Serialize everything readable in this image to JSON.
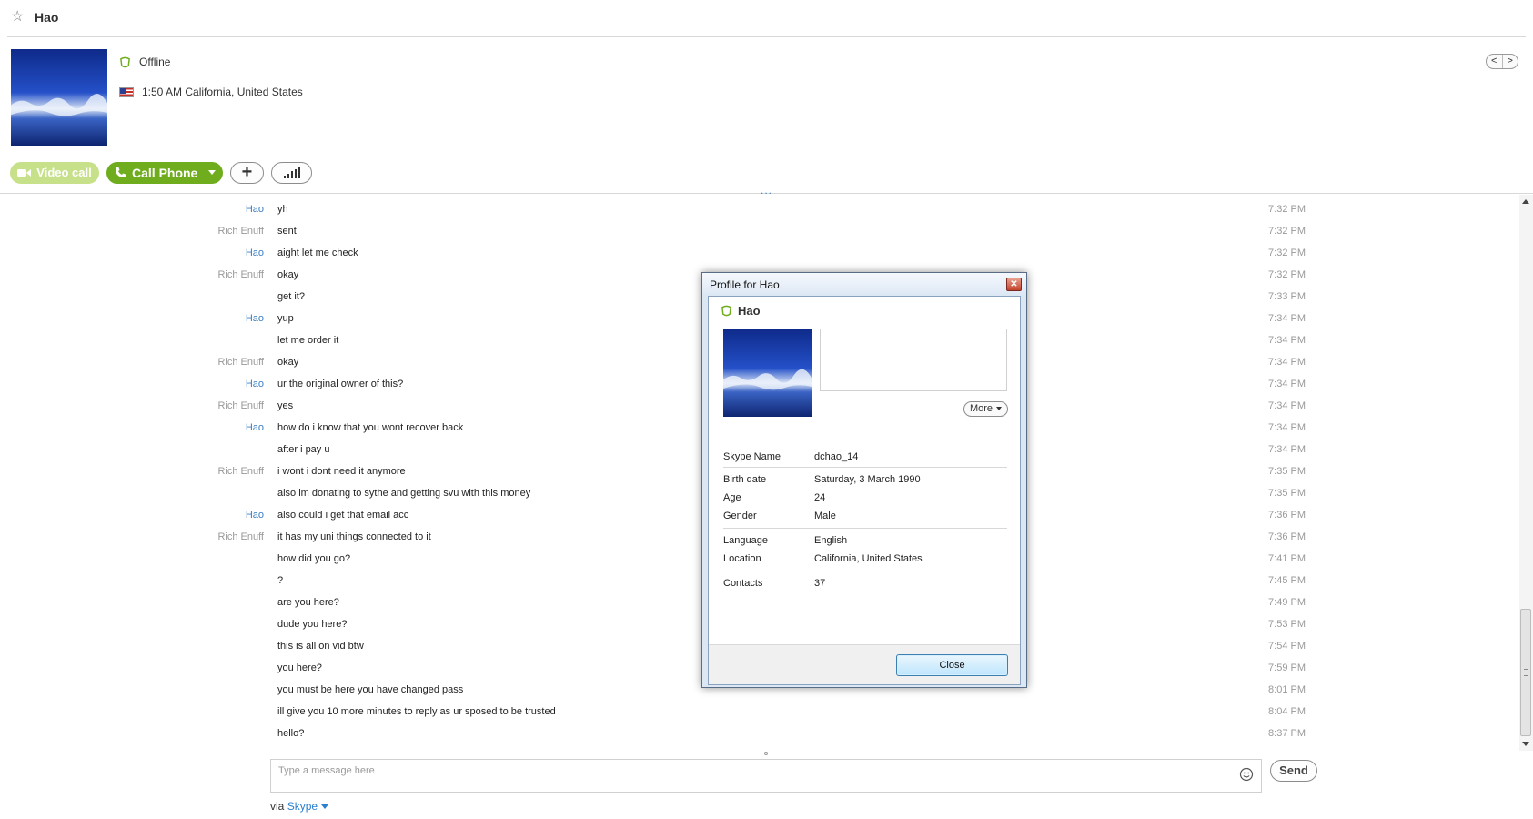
{
  "header": {
    "contact_name": "Hao",
    "status": "Offline",
    "local_time_location": "1:50 AM California, United States",
    "nav_prev": "<",
    "nav_next": ">"
  },
  "toolbar": {
    "video_call_label": "Video call",
    "call_phone_label": "Call Phone",
    "add_label": "+",
    "more_dots": "..."
  },
  "messages": [
    {
      "sender": "Hao",
      "text": "yh",
      "time": "7:32 PM"
    },
    {
      "sender": "Rich Enuff",
      "text": "sent",
      "time": "7:32 PM"
    },
    {
      "sender": "Hao",
      "text": "aight let me check",
      "time": "7:32 PM"
    },
    {
      "sender": "Rich Enuff",
      "text": "okay",
      "time": "7:32 PM"
    },
    {
      "sender": "",
      "text": "get it?",
      "time": "7:33 PM"
    },
    {
      "sender": "Hao",
      "text": "yup",
      "time": "7:34 PM"
    },
    {
      "sender": "",
      "text": "let me order it",
      "time": "7:34 PM"
    },
    {
      "sender": "Rich Enuff",
      "text": "okay",
      "time": "7:34 PM"
    },
    {
      "sender": "Hao",
      "text": "ur the original owner of this?",
      "time": "7:34 PM"
    },
    {
      "sender": "Rich Enuff",
      "text": "yes",
      "time": "7:34 PM"
    },
    {
      "sender": "Hao",
      "text": "how do i know that you wont recover back",
      "time": "7:34 PM"
    },
    {
      "sender": "",
      "text": "after i pay u",
      "time": "7:34 PM"
    },
    {
      "sender": "Rich Enuff",
      "text": "i wont i dont need it anymore",
      "time": "7:35 PM"
    },
    {
      "sender": "",
      "text": "also im donating to sythe and getting svu with this money",
      "time": "7:35 PM"
    },
    {
      "sender": "Hao",
      "text": "also could i get that email acc",
      "time": "7:36 PM"
    },
    {
      "sender": "Rich Enuff",
      "text": "it has my uni things connected to it",
      "time": "7:36 PM"
    },
    {
      "sender": "",
      "text": "how did you go?",
      "time": "7:41 PM"
    },
    {
      "sender": "",
      "text": "?",
      "time": "7:45 PM"
    },
    {
      "sender": "",
      "text": "are you here?",
      "time": "7:49 PM"
    },
    {
      "sender": "",
      "text": "dude you here?",
      "time": "7:53 PM"
    },
    {
      "sender": "",
      "text": "this is all on vid btw",
      "time": "7:54 PM"
    },
    {
      "sender": "",
      "text": "you here?",
      "time": "7:59 PM"
    },
    {
      "sender": "",
      "text": "you must be here you have changed pass",
      "time": "8:01 PM"
    },
    {
      "sender": "",
      "text": "ill give you 10 more minutes to reply as ur sposed to be trusted",
      "time": "8:04 PM"
    },
    {
      "sender": "",
      "text": "hello?",
      "time": "8:37 PM"
    }
  ],
  "compose": {
    "placeholder": "Type a message here",
    "send_label": "Send",
    "via_prefix": "via",
    "via_link": "Skype"
  },
  "profile_dialog": {
    "title": "Profile for Hao",
    "name": "Hao",
    "more_label": "More",
    "close_label": "Close",
    "skype_name_label": "Skype Name",
    "skype_name": "dchao_14",
    "birth_date_label": "Birth date",
    "birth_date": "Saturday, 3 March 1990",
    "age_label": "Age",
    "age": "24",
    "gender_label": "Gender",
    "gender": "Male",
    "language_label": "Language",
    "language": "English",
    "location_label": "Location",
    "location": "California, United States",
    "contacts_label": "Contacts",
    "contacts": "37"
  },
  "colors": {
    "accent_green": "#6fad1f",
    "video_green_disabled": "#c7e08a",
    "sender_hao": "#3b7fc4",
    "sender_other": "#999999",
    "link_blue": "#2a7fd0",
    "status_offline": "#6fad1f"
  },
  "icons": {
    "favorite": "star-icon",
    "status": "offline-status-icon",
    "flag": "us-flag-icon",
    "video": "video-camera-icon",
    "phone": "phone-icon",
    "quality": "signal-bars-icon",
    "emoticon": "smiley-icon"
  }
}
